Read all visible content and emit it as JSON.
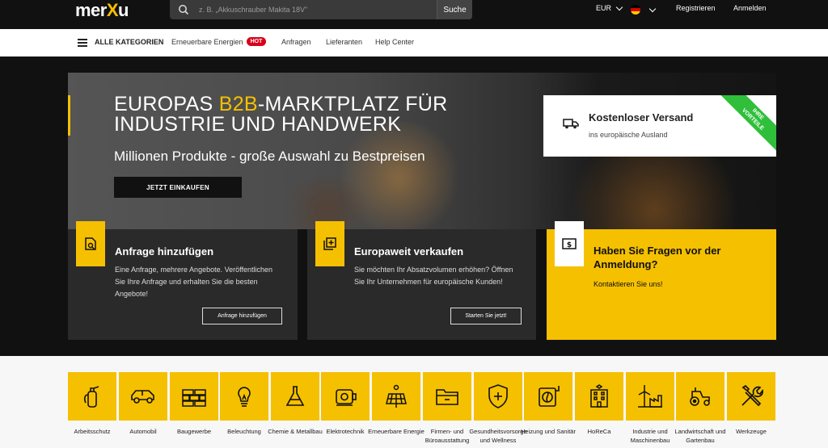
{
  "header": {
    "logo": "merXu",
    "search_placeholder": "z. B. „Akkuschrauber Makita 18V\"",
    "search_button": "Suche",
    "currency": "EUR",
    "register": "Registrieren",
    "login": "Anmelden"
  },
  "nav": {
    "all_categories": "ALLE KATEGORIEN",
    "renewable": "Erneuerbare Energien",
    "hot_badge": "HOT",
    "inquiries": "Anfragen",
    "suppliers": "Lieferanten",
    "help": "Help Center"
  },
  "hero": {
    "title_part1": "EUROPAS ",
    "title_highlight": "B2B",
    "title_part2": "-MARKTPLATZ FÜR",
    "title_line2": "INDUSTRIE UND HANDWERK",
    "subtitle": "Millionen Produkte - große Auswahl zu Bestpreisen",
    "cta": "JETZT EINKAUFEN"
  },
  "shipping": {
    "title": "Kostenloser Versand",
    "text": "ins europäische Ausland",
    "ribbon_line1": "IHRE",
    "ribbon_line2": "VORTEILE"
  },
  "cards": [
    {
      "title": "Anfrage hinzufügen",
      "text": "Eine Anfrage, mehrere Angebote. Veröffentlichen Sie Ihre Anfrage und erhalten Sie die besten Angebote!",
      "button": "Anfrage hinzufügen"
    },
    {
      "title": "Europaweit verkaufen",
      "text": "Sie möchten Ihr Absatzvolumen erhöhen? Öffnen Sie Ihr Unternehmen für europäische Kunden!",
      "button": "Starten Sie jetzt!"
    },
    {
      "title": "Haben Sie Fragen vor der Anmeldung?",
      "text": "Kontaktieren Sie uns!"
    }
  ],
  "categories": [
    "Arbeitsschutz",
    "Automobil",
    "Baugewerbe",
    "Beleuchtung",
    "Chemie & Metallbau",
    "Elektrotechnik",
    "Erneuerbare Energie",
    "Firmen- und Büroausstattung",
    "Gesundheitsvorsorge und Wellness",
    "Heizung und Sanitär",
    "HoReCa",
    "Industrie und Maschinenbau",
    "Landwirtschaft und Gartenbau",
    "Werkzeuge"
  ],
  "colors": {
    "accent": "#f5c000",
    "dark": "#111111",
    "card_dark": "#2a2a2a",
    "hot": "#d9001b",
    "ribbon": "#2fbf3a"
  }
}
